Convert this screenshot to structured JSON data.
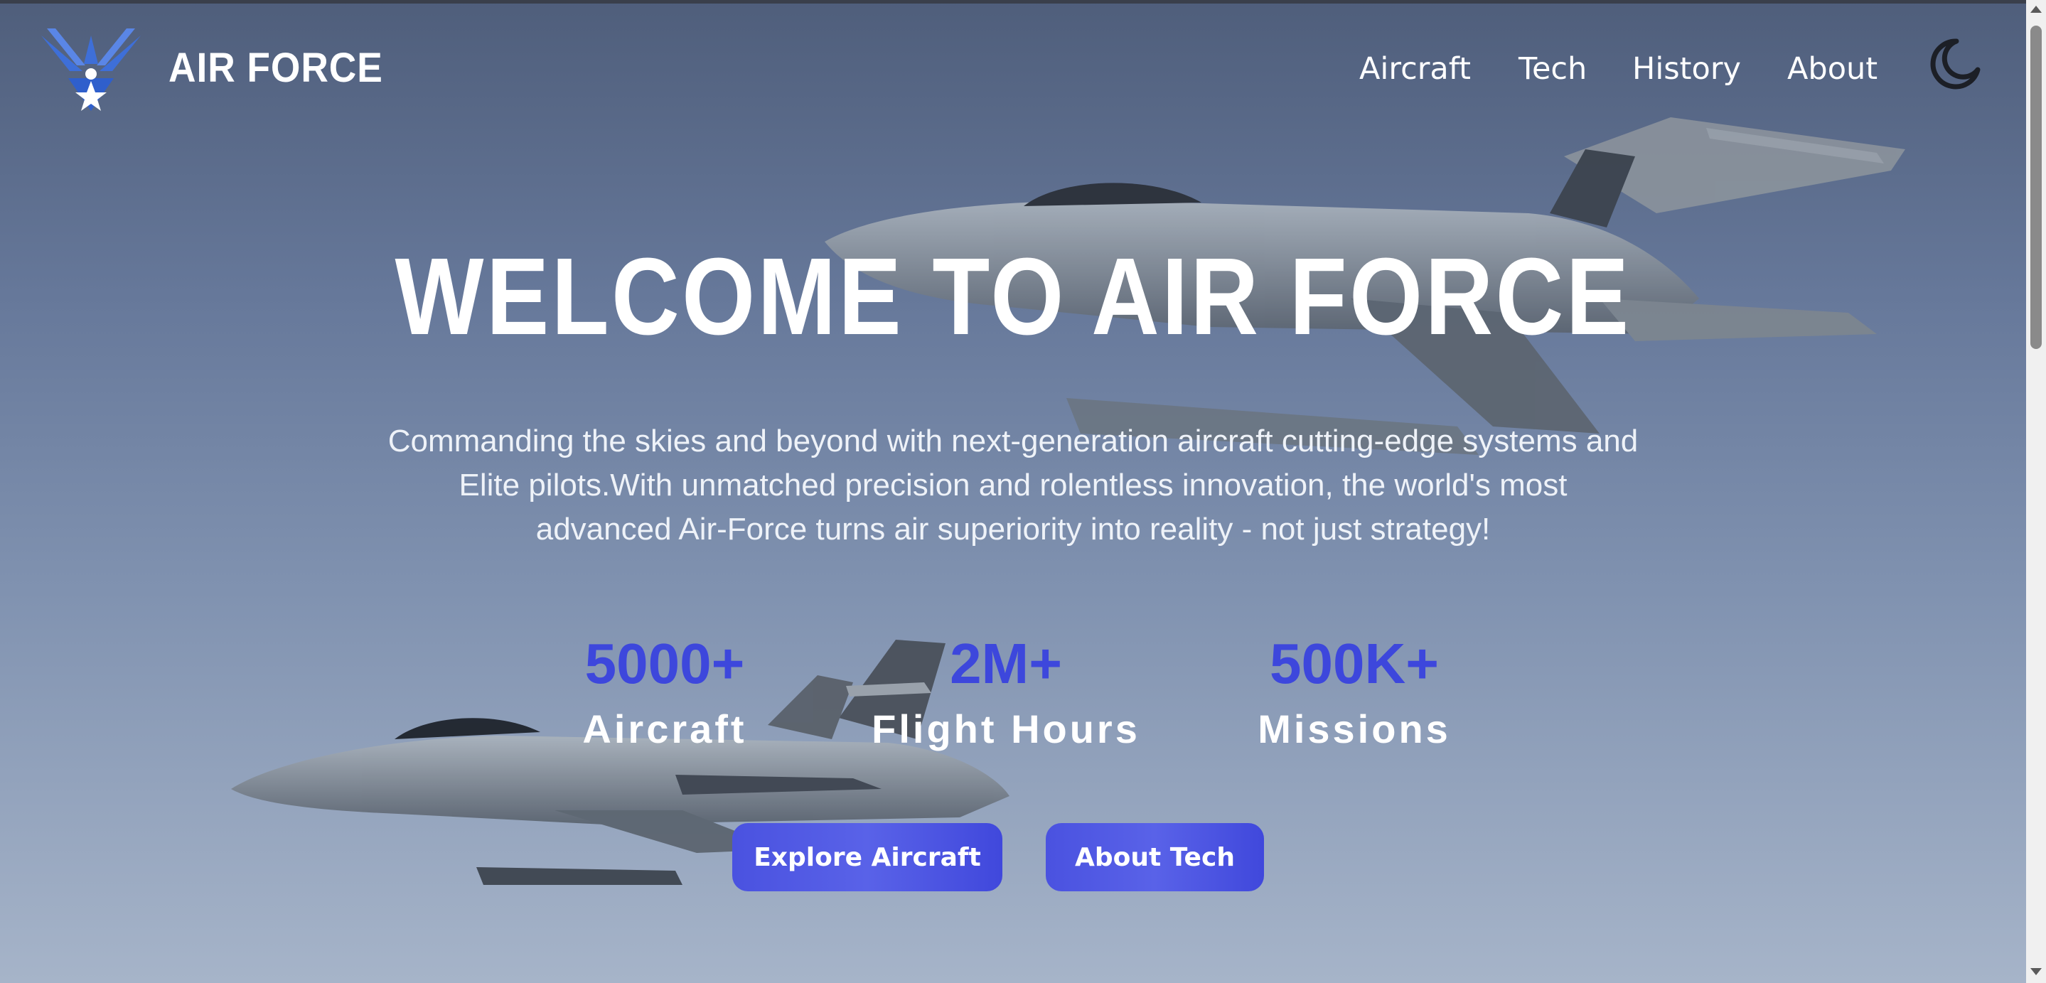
{
  "header": {
    "brand": "AIR FORCE",
    "logo_icon": "air-force-wings-logo",
    "nav": [
      "Aircraft",
      "Tech",
      "History",
      "About"
    ],
    "theme_toggle_icon": "moon-icon"
  },
  "hero": {
    "title": "WELCOME TO AIR FORCE",
    "subtitle_lines": [
      "Commanding the skies and beyond with next-generation aircraft cutting-edge systems and",
      "Elite pilots.With unmatched precision and rolentless innovation, the world's most",
      "advanced Air-Force turns air superiority into reality - not just strategy!"
    ],
    "stats": [
      {
        "value": "5000+",
        "label": "Aircraft"
      },
      {
        "value": "2M+",
        "label": "Flight Hours"
      },
      {
        "value": "500K+",
        "label": "Missions"
      }
    ],
    "buttons": {
      "primary": "Explore Aircraft",
      "secondary": "About Tech"
    }
  },
  "colors": {
    "accent": "#3d47dc",
    "button": "#4a52e0",
    "sky_top": "#4f5e7b",
    "sky_bottom": "#a6b4c9"
  }
}
